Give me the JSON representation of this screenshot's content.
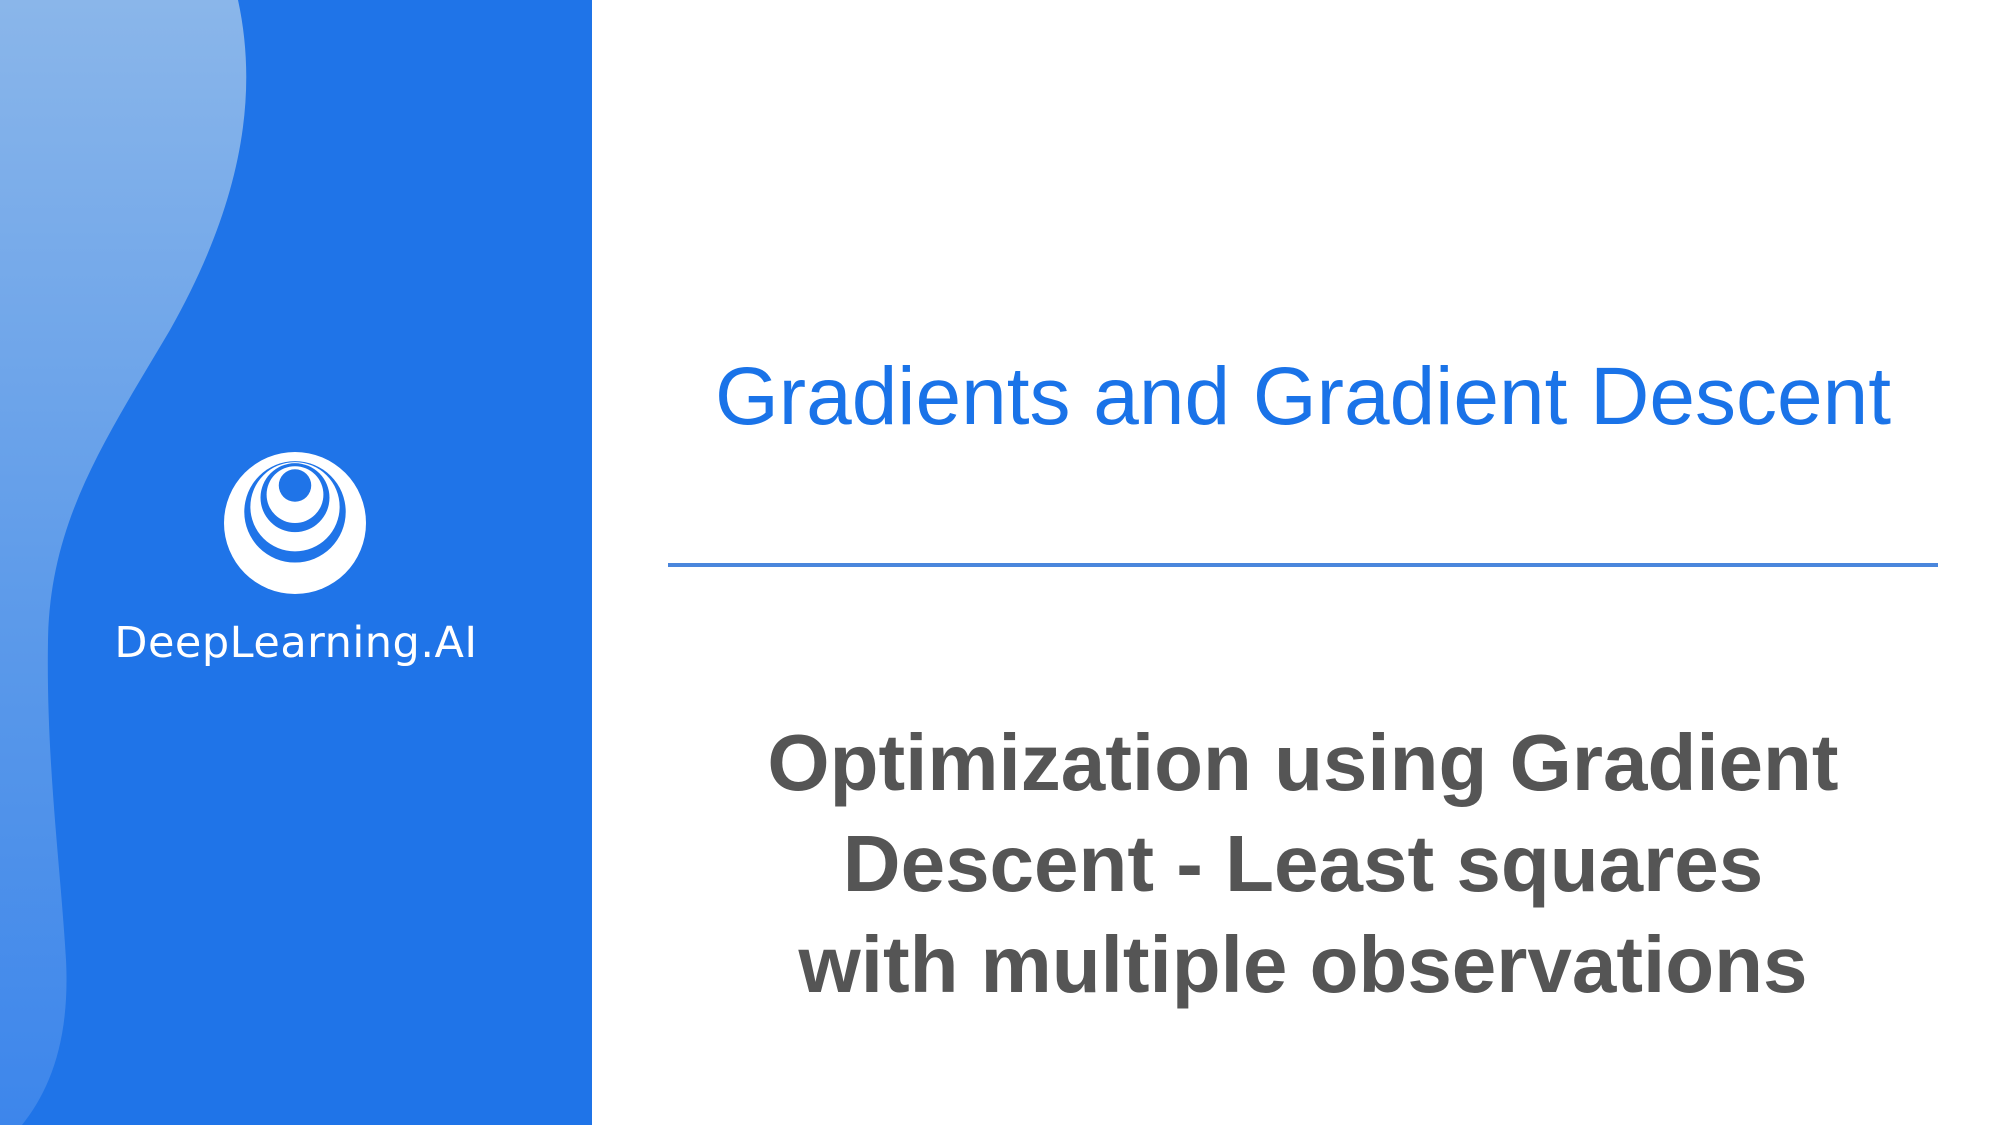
{
  "brand": {
    "name": "DeepLearning.AI",
    "logo_icon": "deeplearning-ai-logo-icon"
  },
  "slide": {
    "section_title": "Gradients and Gradient Descent",
    "lesson_title_lines": [
      "Optimization using Gradient",
      "Descent - Least squares",
      "with multiple observations"
    ]
  },
  "colors": {
    "panel_blue": "#1f74e8",
    "wave_light_blue": "#8ab6ea",
    "title_blue": "#1a73e8",
    "divider_blue": "#4a86dc",
    "lesson_text_gray": "#555555"
  }
}
